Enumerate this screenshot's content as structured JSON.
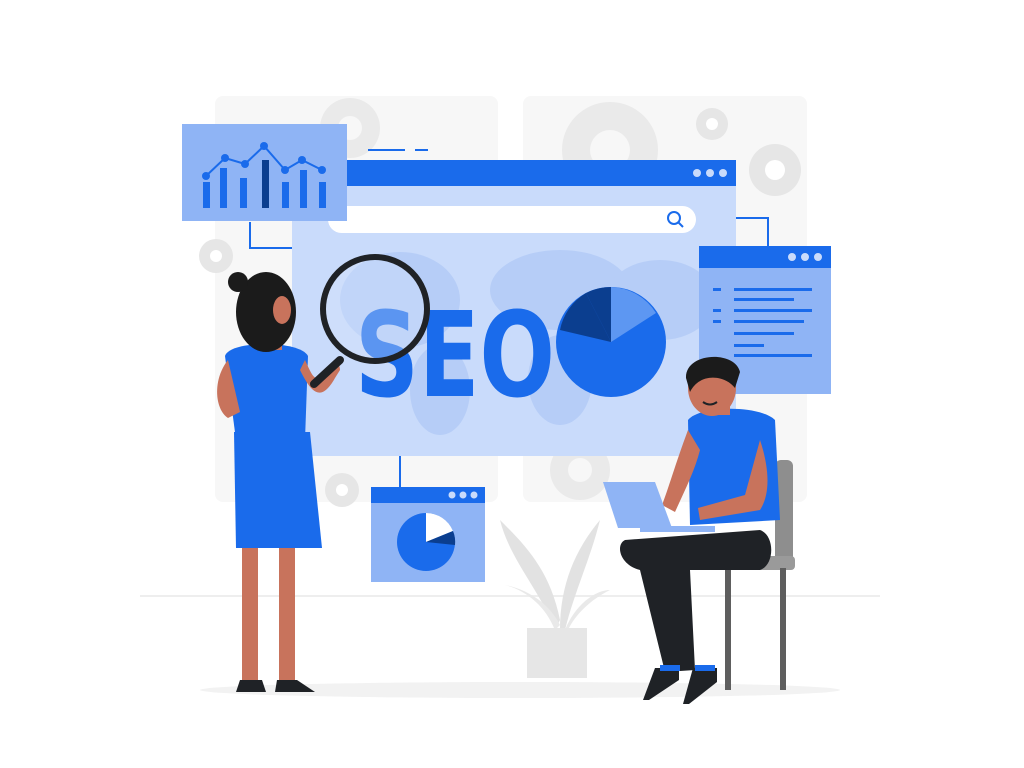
{
  "illustration": {
    "headline": "SEO",
    "colors": {
      "primary": "#1A6BEB",
      "primary_light": "#8FB4F5",
      "panel_light": "#C9DBFB",
      "dark_blue": "#0B3E8F",
      "skin": "#C8735C",
      "hair": "#1B1B1B",
      "pants": "#1F2226",
      "gray_bg": "#F2F2F2",
      "gray_mid": "#DADADA",
      "chair": "#8E8E8E"
    },
    "icons": [
      "bar-line-chart-icon",
      "search-icon",
      "pie-chart-icon",
      "magnifying-glass-icon",
      "gear-icon",
      "laptop-icon",
      "plant-icon",
      "world-map-icon"
    ]
  }
}
